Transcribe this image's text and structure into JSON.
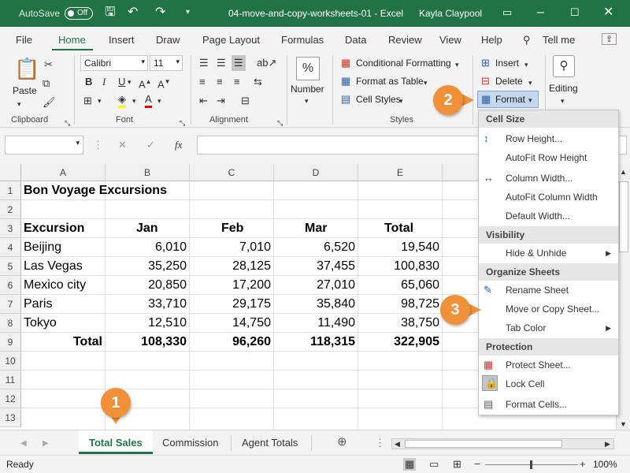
{
  "titlebar": {
    "autosave": "AutoSave",
    "toggle": "Off",
    "doc_title": "04-move-and-copy-worksheets-01  -  Excel",
    "user": "Kayla Claypool"
  },
  "tabs": [
    "File",
    "Home",
    "Insert",
    "Draw",
    "Page Layout",
    "Formulas",
    "Data",
    "Review",
    "View",
    "Help"
  ],
  "tell_me": "Tell me",
  "ribbon": {
    "paste": "Paste",
    "font_name": "Calibri",
    "font_size": "11",
    "number": "Number",
    "number_icon": "%",
    "conditional_formatting": "Conditional Formatting",
    "format_as_table": "Format as Table",
    "cell_styles": "Cell Styles",
    "insert": "Insert",
    "delete": "Delete",
    "format": "Format",
    "editing": "Editing",
    "groups": {
      "clipboard": "Clipboard",
      "font": "Font",
      "alignment": "Alignment",
      "styles": "Styles"
    }
  },
  "formula_bar": {
    "fx": "fx",
    "cancel": "✕",
    "enter": "✓"
  },
  "columns": [
    "A",
    "B",
    "C",
    "D",
    "E"
  ],
  "rows": [
    "1",
    "2",
    "3",
    "4",
    "5",
    "6",
    "7",
    "8",
    "9",
    "10",
    "11",
    "12",
    "13"
  ],
  "sheet": {
    "title": "Bon Voyage Excursions",
    "headers": [
      "Excursion",
      "Jan",
      "Feb",
      "Mar",
      "Total"
    ],
    "data": [
      [
        "Beijing",
        "6,010",
        "7,010",
        "6,520",
        "19,540"
      ],
      [
        "Las Vegas",
        "35,250",
        "28,125",
        "37,455",
        "100,830"
      ],
      [
        "Mexico city",
        "20,850",
        "17,200",
        "27,010",
        "65,060"
      ],
      [
        "Paris",
        "33,710",
        "29,175",
        "35,840",
        "98,725"
      ],
      [
        "Tokyo",
        "12,510",
        "14,750",
        "11,490",
        "38,750"
      ]
    ],
    "total": [
      "Total",
      "108,330",
      "96,260",
      "118,315",
      "322,905"
    ]
  },
  "sheet_tabs": [
    "Total Sales",
    "Commission",
    "Agent Totals"
  ],
  "status": {
    "ready": "Ready",
    "zoom": "100%"
  },
  "menu": {
    "cell_size": "Cell Size",
    "row_height": "Row Height...",
    "autofit_row": "AutoFit Row Height",
    "column_width": "Column Width...",
    "autofit_column": "AutoFit Column Width",
    "default_width": "Default Width...",
    "visibility": "Visibility",
    "hide_unhide": "Hide & Unhide",
    "organize": "Organize Sheets",
    "rename": "Rename Sheet",
    "move_copy": "Move or Copy Sheet...",
    "tab_color": "Tab Color",
    "protection": "Protection",
    "protect_sheet": "Protect Sheet...",
    "lock_cell": "Lock Cell",
    "format_cells": "Format Cells..."
  },
  "callouts": [
    "1",
    "2",
    "3"
  ],
  "colors": {
    "excel_green": "#217346",
    "callout_orange": "#f0913a"
  }
}
